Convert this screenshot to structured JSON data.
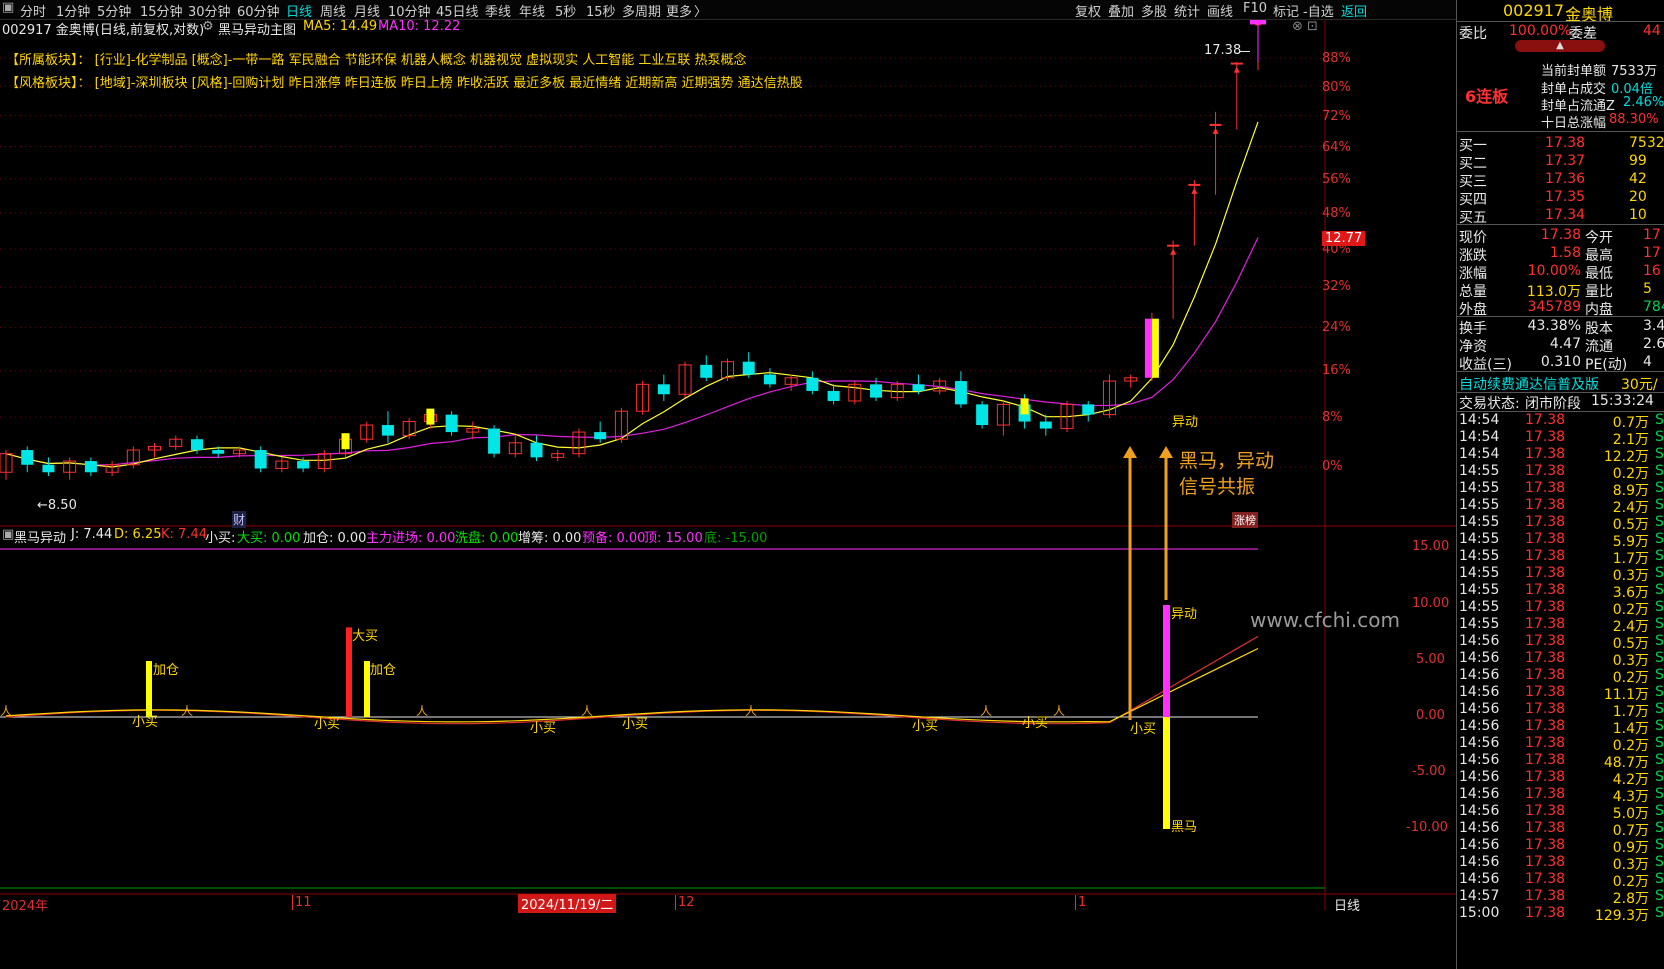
{
  "toolbar": {
    "periods": [
      "分时",
      "1分钟",
      "5分钟",
      "15分钟",
      "30分钟",
      "60分钟",
      "日线",
      "周线",
      "月线",
      "10分钟",
      "45日线",
      "季线",
      "年线",
      "5秒",
      "15秒",
      "多周期",
      "更多"
    ],
    "active_period": "日线",
    "right_buttons": [
      "复权",
      "叠加",
      "多股",
      "统计",
      "画线",
      "F10",
      "标记",
      "-自选",
      "返回"
    ],
    "more_arrow": "〉"
  },
  "chart_title": {
    "code_name": "002917 金奥博(日线,前复权,对数)",
    "indicator_name": "黑马异动主图",
    "ma5": "MA5: 14.49",
    "ma10": "MA10: 12.22",
    "close_controls": "⊗ ⊡"
  },
  "sectors": {
    "line1": "【所属板块】： [行业]-化学制品 [概念]-一带一路 军民融合 节能环保 机器人概念 机器视觉 虚拟现实 人工智能 工业互联 热泵概念",
    "line2": "【风格板块】： [地域]-深圳板块 [风格]-回购计划 昨日涨停 昨日连板 昨日上榜 昨收活跃 最近多板 最近情绪 近期新高 近期强势 通达信热股"
  },
  "price_axis": [
    "88%",
    "80%",
    "72%",
    "64%",
    "56%",
    "48%",
    "40%",
    "32%",
    "24%",
    "16%",
    "8%",
    "0%"
  ],
  "current_price_tag": "12.77",
  "high_marker": "17.38",
  "low_marker": "←8.50",
  "annotations": {
    "resonance_line1": "黑马，异动",
    "resonance_line2": "信号共振",
    "signal_label_main": "异动",
    "cai_badge": "财",
    "zhangbang_badge": "涨榜"
  },
  "indicator": {
    "name": "黑马异动",
    "values": [
      {
        "label": "J: 7.44",
        "color": "#e8e8e8"
      },
      {
        "label": "D: 6.25",
        "color": "#ffd700"
      },
      {
        "label": "K: 7.44",
        "color": "#ff3030"
      },
      {
        "label": "小买:",
        "color": "#e8e8e8"
      },
      {
        "label": "大买: 0.00",
        "color": "#00e000"
      },
      {
        "label": "加仓: 0.00",
        "color": "#e8e8e8"
      },
      {
        "label": "主力进场: 0.00",
        "color": "#ff30ff"
      },
      {
        "label": "洗盘: 0.00",
        "color": "#00e000"
      },
      {
        "label": "增筹: 0.00",
        "color": "#e8e8e8"
      },
      {
        "label": "预备: 0.00",
        "color": "#ff30ff"
      },
      {
        "label": "顶: 15.00",
        "color": "#ff30ff"
      },
      {
        "label": "底: -15.00",
        "color": "#00a000"
      }
    ],
    "axis": [
      "15.00",
      "10.00",
      "5.00",
      "0.00",
      "-5.00",
      "-10.00"
    ],
    "labels": {
      "jiacang": "加仓",
      "damai": "大买",
      "xiaomai": "小买",
      "yidong": "异动",
      "heima": "黑马"
    }
  },
  "watermark": "www.cfchi.com",
  "date_axis": {
    "year": "2024年",
    "m11": "11",
    "selected": "2024/11/19/二",
    "m12": "12",
    "m1": "1",
    "period_tab": "日线"
  },
  "right_panel": {
    "code": "002917",
    "name": "金奥博",
    "weibi_label": "委比",
    "weibi_value": "100.00%",
    "weicha_label": "委差",
    "weicha_value": "44",
    "lianban": "6连板",
    "seal_stats": [
      {
        "label": "当前封单额",
        "value": "7533万",
        "color": "#e8e8e8"
      },
      {
        "label": "封单占成交",
        "value": "0.04倍",
        "color": "#00dcdc"
      },
      {
        "label": "封单占流通Z",
        "value": "2.46%",
        "color": "#00dcdc"
      },
      {
        "label": "十日总涨幅",
        "value": "88.30%",
        "color": "#ff3030"
      }
    ],
    "bids": [
      {
        "label": "买一",
        "price": "17.38",
        "vol": "7532"
      },
      {
        "label": "买二",
        "price": "17.37",
        "vol": "99"
      },
      {
        "label": "买三",
        "price": "17.36",
        "vol": "42"
      },
      {
        "label": "买四",
        "price": "17.35",
        "vol": "20"
      },
      {
        "label": "买五",
        "price": "17.34",
        "vol": "10"
      }
    ],
    "quote": [
      {
        "l1": "现价",
        "v1": "17.38",
        "c1": "#ff3030",
        "l2": "今开",
        "v2": "17",
        "c2": "#ff3030"
      },
      {
        "l1": "涨跌",
        "v1": "1.58",
        "c1": "#ff3030",
        "l2": "最高",
        "v2": "17",
        "c2": "#ff3030"
      },
      {
        "l1": "涨幅",
        "v1": "10.00%",
        "c1": "#ff3030",
        "l2": "最低",
        "v2": "16",
        "c2": "#ff3030"
      },
      {
        "l1": "总量",
        "v1": "113.0万",
        "c1": "#ffd700",
        "l2": "量比",
        "v2": "5",
        "c2": "#ffd700"
      },
      {
        "l1": "外盘",
        "v1": "345789",
        "c1": "#ff3030",
        "l2": "内盘",
        "v2": "784",
        "c2": "#00d050"
      }
    ],
    "fund": [
      {
        "l1": "换手",
        "v1": "43.38%",
        "l2": "股本",
        "v2": "3.4"
      },
      {
        "l1": "净资",
        "v1": "4.47",
        "l2": "流通",
        "v2": "2.6"
      },
      {
        "l1": "收益(三)",
        "v1": "0.310",
        "l2": "PE(动)",
        "v2": "4"
      }
    ],
    "promo": "自动续费通达信普及版",
    "promo_price": "30元/",
    "status_label": "交易状态:",
    "status_value": "闭市阶段",
    "status_time": "15:33:24",
    "ticks": [
      {
        "t": "14:54",
        "p": "17.38",
        "v": "0.7万",
        "s": "S"
      },
      {
        "t": "14:54",
        "p": "17.38",
        "v": "2.1万",
        "s": "S"
      },
      {
        "t": "14:54",
        "p": "17.38",
        "v": "12.2万",
        "s": "S"
      },
      {
        "t": "14:55",
        "p": "17.38",
        "v": "0.2万",
        "s": "S"
      },
      {
        "t": "14:55",
        "p": "17.38",
        "v": "8.9万",
        "s": "S"
      },
      {
        "t": "14:55",
        "p": "17.38",
        "v": "2.4万",
        "s": "S"
      },
      {
        "t": "14:55",
        "p": "17.38",
        "v": "0.5万",
        "s": "S"
      },
      {
        "t": "14:55",
        "p": "17.38",
        "v": "5.9万",
        "s": "S"
      },
      {
        "t": "14:55",
        "p": "17.38",
        "v": "1.7万",
        "s": "S"
      },
      {
        "t": "14:55",
        "p": "17.38",
        "v": "0.3万",
        "s": "S"
      },
      {
        "t": "14:55",
        "p": "17.38",
        "v": "3.6万",
        "s": "S"
      },
      {
        "t": "14:55",
        "p": "17.38",
        "v": "0.2万",
        "s": "S"
      },
      {
        "t": "14:55",
        "p": "17.38",
        "v": "2.4万",
        "s": "S"
      },
      {
        "t": "14:56",
        "p": "17.38",
        "v": "0.5万",
        "s": "S"
      },
      {
        "t": "14:56",
        "p": "17.38",
        "v": "0.3万",
        "s": "S"
      },
      {
        "t": "14:56",
        "p": "17.38",
        "v": "0.2万",
        "s": "S"
      },
      {
        "t": "14:56",
        "p": "17.38",
        "v": "11.1万",
        "s": "S"
      },
      {
        "t": "14:56",
        "p": "17.38",
        "v": "1.7万",
        "s": "S"
      },
      {
        "t": "14:56",
        "p": "17.38",
        "v": "1.4万",
        "s": "S"
      },
      {
        "t": "14:56",
        "p": "17.38",
        "v": "0.2万",
        "s": "S"
      },
      {
        "t": "14:56",
        "p": "17.38",
        "v": "48.7万",
        "s": "S"
      },
      {
        "t": "14:56",
        "p": "17.38",
        "v": "4.2万",
        "s": "S"
      },
      {
        "t": "14:56",
        "p": "17.38",
        "v": "4.3万",
        "s": "S"
      },
      {
        "t": "14:56",
        "p": "17.38",
        "v": "5.0万",
        "s": "S"
      },
      {
        "t": "14:56",
        "p": "17.38",
        "v": "0.7万",
        "s": "S"
      },
      {
        "t": "14:56",
        "p": "17.38",
        "v": "0.9万",
        "s": "S"
      },
      {
        "t": "14:56",
        "p": "17.38",
        "v": "0.3万",
        "s": "S"
      },
      {
        "t": "14:56",
        "p": "17.38",
        "v": "0.2万",
        "s": "S"
      },
      {
        "t": "14:57",
        "p": "17.38",
        "v": "2.8万",
        "s": "S"
      },
      {
        "t": "15:00",
        "p": "17.38",
        "v": "129.3万",
        "s": "S"
      }
    ]
  },
  "chart_data": {
    "type": "candlestick",
    "series": [
      {
        "name": "K线",
        "values": [
          [
            8.6,
            8.9,
            8.5,
            8.85
          ],
          [
            8.9,
            8.95,
            8.6,
            8.7
          ],
          [
            8.7,
            8.8,
            8.55,
            8.6
          ],
          [
            8.6,
            8.8,
            8.5,
            8.75
          ],
          [
            8.75,
            8.8,
            8.55,
            8.6
          ],
          [
            8.6,
            8.75,
            8.55,
            8.7
          ],
          [
            8.7,
            8.95,
            8.65,
            8.9
          ],
          [
            8.9,
            9.0,
            8.8,
            8.95
          ],
          [
            8.95,
            9.1,
            8.9,
            9.05
          ],
          [
            9.05,
            9.1,
            8.85,
            8.9
          ],
          [
            8.9,
            8.95,
            8.8,
            8.85
          ],
          [
            8.85,
            8.95,
            8.8,
            8.9
          ],
          [
            8.9,
            8.95,
            8.6,
            8.65
          ],
          [
            8.65,
            8.8,
            8.6,
            8.75
          ],
          [
            8.75,
            8.8,
            8.6,
            8.65
          ],
          [
            8.65,
            8.9,
            8.6,
            8.85
          ],
          [
            8.85,
            9.1,
            8.8,
            9.05
          ],
          [
            9.05,
            9.3,
            9.0,
            9.25
          ],
          [
            9.25,
            9.45,
            9.0,
            9.1
          ],
          [
            9.1,
            9.35,
            9.05,
            9.3
          ],
          [
            9.3,
            9.45,
            9.2,
            9.4
          ],
          [
            9.4,
            9.45,
            9.1,
            9.15
          ],
          [
            9.15,
            9.3,
            9.05,
            9.2
          ],
          [
            9.2,
            9.25,
            8.8,
            8.85
          ],
          [
            8.85,
            9.1,
            8.8,
            9.0
          ],
          [
            9.0,
            9.1,
            8.75,
            8.8
          ],
          [
            8.8,
            8.9,
            8.75,
            8.85
          ],
          [
            8.85,
            9.2,
            8.8,
            9.15
          ],
          [
            9.15,
            9.3,
            9.0,
            9.05
          ],
          [
            9.05,
            9.5,
            9.0,
            9.45
          ],
          [
            9.45,
            9.9,
            9.4,
            9.85
          ],
          [
            9.85,
            10.0,
            9.6,
            9.7
          ],
          [
            9.7,
            10.2,
            9.65,
            10.15
          ],
          [
            10.15,
            10.3,
            9.9,
            9.95
          ],
          [
            9.95,
            10.25,
            9.9,
            10.2
          ],
          [
            10.2,
            10.35,
            9.95,
            10.0
          ],
          [
            10.0,
            10.1,
            9.8,
            9.85
          ],
          [
            9.85,
            10.0,
            9.75,
            9.95
          ],
          [
            9.95,
            10.05,
            9.7,
            9.75
          ],
          [
            9.75,
            9.85,
            9.55,
            9.6
          ],
          [
            9.6,
            9.9,
            9.55,
            9.85
          ],
          [
            9.85,
            9.95,
            9.6,
            9.65
          ],
          [
            9.65,
            9.9,
            9.6,
            9.85
          ],
          [
            9.85,
            10.0,
            9.7,
            9.75
          ],
          [
            9.75,
            9.95,
            9.7,
            9.9
          ],
          [
            9.9,
            10.05,
            9.5,
            9.55
          ],
          [
            9.55,
            9.6,
            9.2,
            9.25
          ],
          [
            9.25,
            9.6,
            9.1,
            9.55
          ],
          [
            9.55,
            9.7,
            9.2,
            9.3
          ],
          [
            9.3,
            9.4,
            9.1,
            9.2
          ],
          [
            9.2,
            9.6,
            9.15,
            9.55
          ],
          [
            9.55,
            9.6,
            9.3,
            9.4
          ],
          [
            9.4,
            10.0,
            9.35,
            9.9
          ],
          [
            9.9,
            10.0,
            9.8,
            9.95
          ],
          [
            9.95,
            11.0,
            9.9,
            10.9
          ],
          [
            10.9,
            12.3,
            10.9,
            12.2
          ],
          [
            12.2,
            13.5,
            12.2,
            13.4
          ],
          [
            13.4,
            15.0,
            13.2,
            14.7
          ],
          [
            14.7,
            16.2,
            14.6,
            16.16
          ],
          [
            16.16,
            17.38,
            16.0,
            17.38
          ]
        ]
      },
      {
        "name": "MA5",
        "values": []
      },
      {
        "name": "MA10",
        "values": []
      }
    ],
    "ylim_pct": [
      0,
      88
    ],
    "log_scale": true
  }
}
